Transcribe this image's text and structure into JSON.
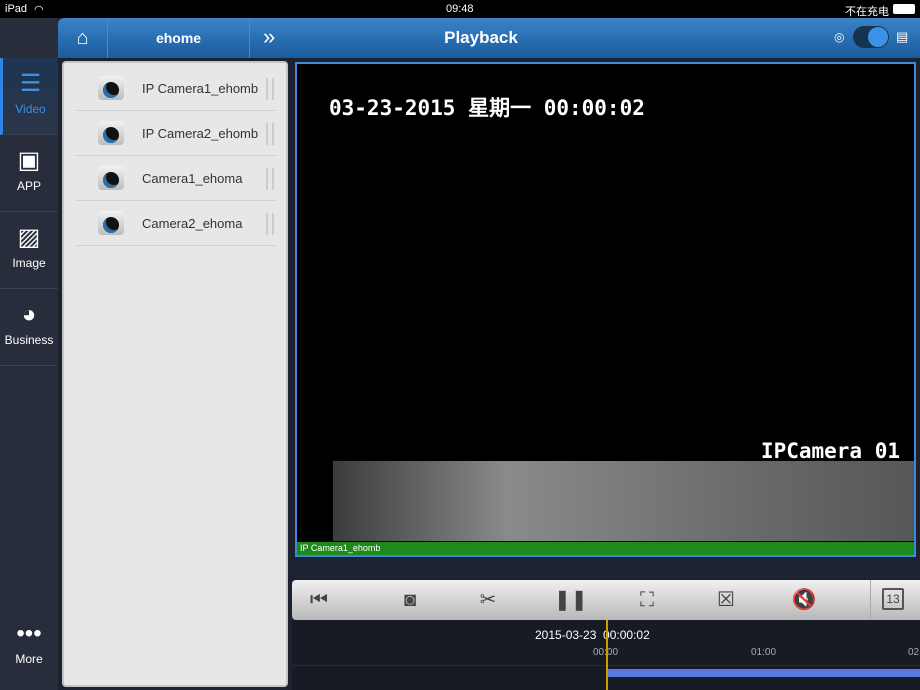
{
  "status": {
    "device": "iPad",
    "time": "09:48",
    "battery": "不在充电"
  },
  "sidebar": {
    "items": [
      {
        "label": "Video",
        "icon": "video-list-icon"
      },
      {
        "label": "APP",
        "icon": "app-icon"
      },
      {
        "label": "Image",
        "icon": "image-icon"
      },
      {
        "label": "Business",
        "icon": "pie-chart-icon"
      },
      {
        "label": "More",
        "icon": "more-icon"
      }
    ]
  },
  "header": {
    "location": "ehome",
    "title": "Playback"
  },
  "cameras": [
    {
      "label": "IP Camera1_ehomb"
    },
    {
      "label": "IP Camera2_ehomb"
    },
    {
      "label": "Camera1_ehoma"
    },
    {
      "label": "Camera2_ehoma"
    }
  ],
  "video": {
    "osd_datetime": "03-23-2015 星期一 00:00:02",
    "osd_camera": "IPCamera 01",
    "channel_label": "IP Camera1_ehomb"
  },
  "timeline": {
    "current": "2015-03-23  00:00:02",
    "ticks": [
      "00:00",
      "01:00",
      "02"
    ],
    "calendar_day": "13"
  }
}
